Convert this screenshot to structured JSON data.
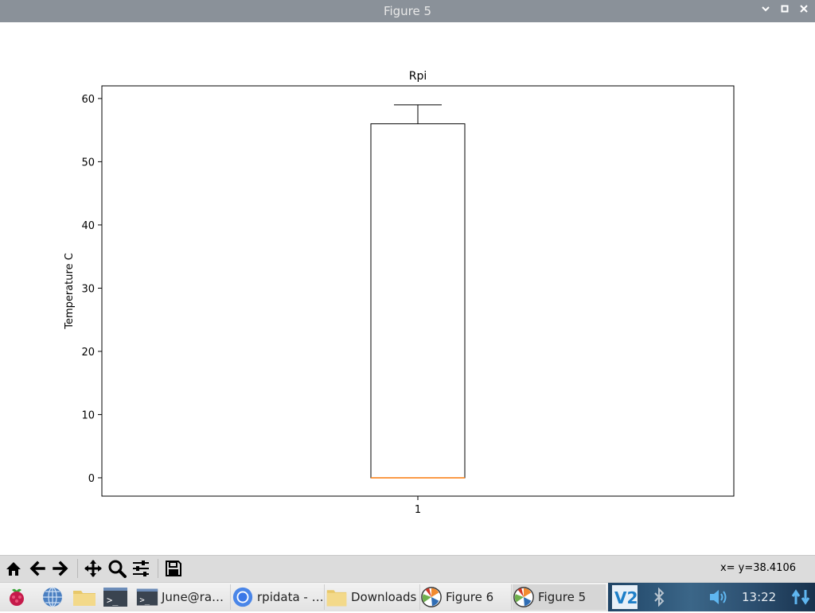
{
  "window": {
    "title": "Figure 5"
  },
  "chart_data": {
    "type": "boxplot",
    "title": "Rpi",
    "xlabel": "",
    "ylabel": "Temperature C",
    "categories": [
      "1"
    ],
    "yticks": [
      0,
      10,
      20,
      30,
      40,
      50,
      60
    ],
    "ylim": [
      -2.9,
      62
    ],
    "boxes": [
      {
        "label": "1",
        "whisker_low": 0,
        "q1": 0,
        "median": 0,
        "q3": 56,
        "whisker_high": 59
      }
    ],
    "colors": {
      "box": "#000000",
      "median": "#ff7f0e",
      "whisker": "#000000"
    },
    "grid": false
  },
  "toolbar": {
    "buttons": [
      "home-icon",
      "back-arrow-icon",
      "forward-arrow-icon",
      "pan-icon",
      "zoom-icon",
      "configure-subplots-icon",
      "save-icon"
    ],
    "coords": "x= y=38.4106"
  },
  "taskbar": {
    "launchers": [
      "raspberry-menu-icon",
      "web-browser-icon",
      "file-manager-icon",
      "terminal-icon"
    ],
    "tasks": [
      {
        "label": "June@ra…",
        "icon": "terminal-icon"
      },
      {
        "label": "rpidata - …",
        "icon": "chromium-icon"
      },
      {
        "label": "Downloads",
        "icon": "folder-icon"
      },
      {
        "label": "Figure 6",
        "icon": "matplotlib-icon"
      },
      {
        "label": "Figure 5",
        "icon": "matplotlib-icon"
      }
    ],
    "tray": [
      "vnc-icon",
      "bluetooth-icon",
      "volume-icon",
      "network-icon"
    ],
    "clock": "13:22"
  }
}
